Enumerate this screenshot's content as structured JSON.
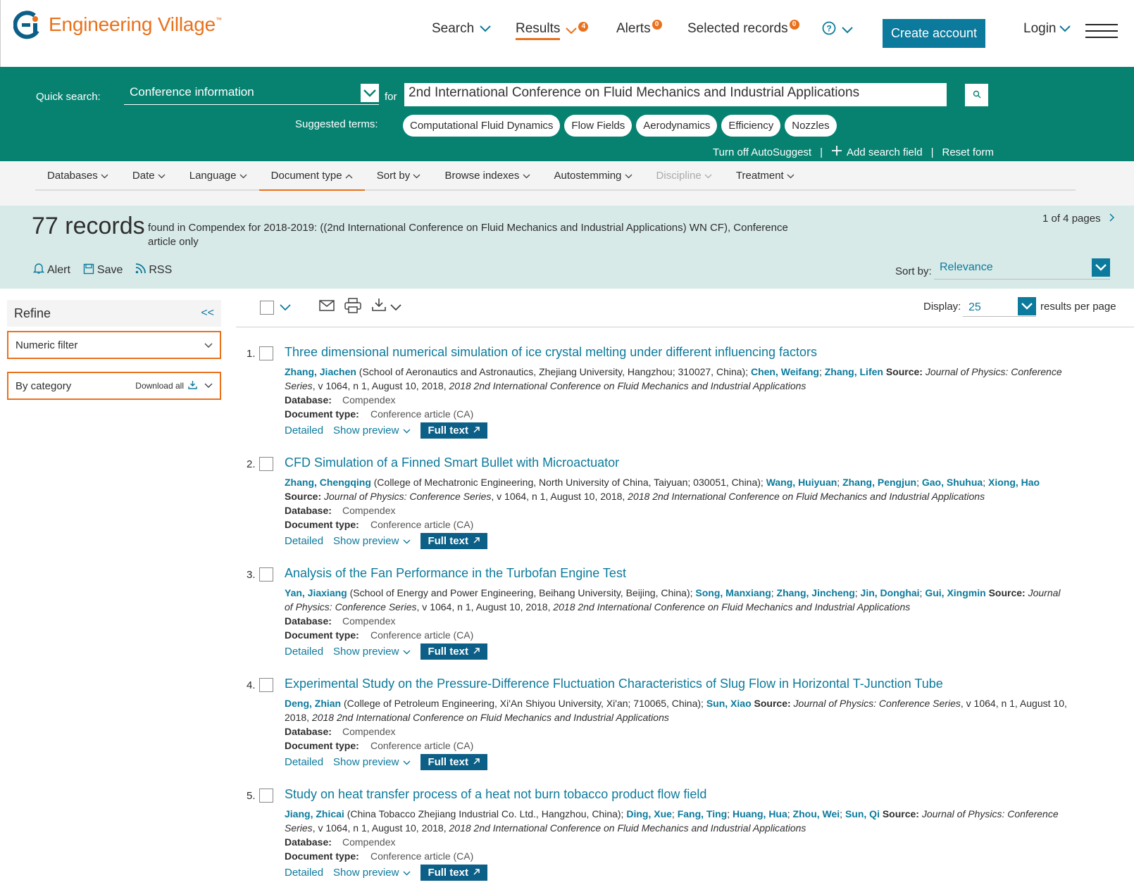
{
  "brand": {
    "name": "Engineering Village",
    "tm": "™",
    "accent": "#e9711c",
    "primary": "#0c7a9c",
    "green": "#078271"
  },
  "topnav": {
    "search": "Search",
    "results": "Results",
    "results_badge": "4",
    "alerts": "Alerts",
    "alerts_badge": "0",
    "selected": "Selected records",
    "selected_badge": "0",
    "help_icon": "help-circle-icon",
    "create_account": "Create account",
    "login": "Login"
  },
  "quick_search": {
    "label": "Quick search:",
    "field": "Conference information",
    "for": "for",
    "query": "2nd International Conference on Fluid Mechanics and Industrial Applications",
    "suggested_label": "Suggested terms:",
    "suggested": [
      "Computational Fluid Dynamics",
      "Flow Fields",
      "Aerodynamics",
      "Efficiency",
      "Nozzles"
    ],
    "turn_off": "Turn off AutoSuggest",
    "add_field": "Add search field",
    "reset": "Reset form"
  },
  "toolbar": [
    "Databases",
    "Date",
    "Language",
    "Document type",
    "Sort by",
    "Browse indexes",
    "Autostemming",
    "Discipline",
    "Treatment"
  ],
  "banner": {
    "count": "77 records",
    "description": "found in Compendex for 2018-2019: ((2nd International Conference on Fluid Mechanics and Industrial Applications) WN CF), Conference article only",
    "pages": "1 of 4 pages",
    "alert": "Alert",
    "save": "Save",
    "rss": "RSS",
    "sort_label": "Sort by:",
    "sort_value": "Relevance"
  },
  "refine": {
    "title": "Refine",
    "collapse": "<<",
    "numeric": "Numeric filter",
    "category": "By category",
    "download_all": "Download all"
  },
  "display": {
    "label": "Display:",
    "value": "25",
    "after": "results per page"
  },
  "labels": {
    "database": "Database:",
    "doctype": "Document type:",
    "detailed": "Detailed",
    "preview": "Show preview",
    "fulltext": "Full text",
    "source": "Source:"
  },
  "records": [
    {
      "num": "1.",
      "title": "Three dimensional numerical simulation of ice crystal melting under different influencing factors",
      "first_author": "Zhang, Jiachen",
      "affil": " (School of Aeronautics and Astronautics, Zhejiang University, Hangzhou; 310027, China); ",
      "others": [
        "Chen, Weifang",
        "Zhang, Lifen"
      ],
      "source_journal": "Journal of Physics: Conference Series",
      "source_rest": ", v 1064, n 1, August 10, 2018, ",
      "source_conf": "2018 2nd International Conference on Fluid Mechanics and Industrial Applications",
      "database": "Compendex",
      "doctype": "Conference article (CA)"
    },
    {
      "num": "2.",
      "title": "CFD Simulation of a Finned Smart Bullet with Microactuator",
      "first_author": "Zhang, Chengqing",
      "affil": " (College of Mechatronic Engineering, North University of China, Taiyuan; 030051, China); ",
      "others": [
        "Wang, Huiyuan",
        "Zhang, Pengjun",
        "Gao, Shuhua",
        "Xiong, Hao"
      ],
      "source_journal": "Journal of Physics: Conference Series",
      "source_rest": ", v 1064, n 1, August 10, 2018, ",
      "source_conf": "2018 2nd International Conference on Fluid Mechanics and Industrial Applications",
      "database": "Compendex",
      "doctype": "Conference article (CA)"
    },
    {
      "num": "3.",
      "title": "Analysis of the Fan Performance in the Turbofan Engine Test",
      "first_author": "Yan, Jiaxiang",
      "affil": " (School of Energy and Power Engineering, Beihang University, Beijing, China); ",
      "others": [
        "Song, Manxiang",
        "Zhang, Jincheng",
        "Jin, Donghai",
        "Gui, Xingmin"
      ],
      "source_journal": "Journal of Physics: Conference Series",
      "source_rest": ", v 1064, n 1, August 10, 2018, ",
      "source_conf": "2018 2nd International Conference on Fluid Mechanics and Industrial Applications",
      "database": "Compendex",
      "doctype": "Conference article (CA)"
    },
    {
      "num": "4.",
      "title": "Experimental Study on the Pressure-Difference Fluctuation Characteristics of Slug Flow in Horizontal T-Junction Tube",
      "first_author": "Deng, Zhian",
      "affil": " (College of Petroleum Engineering, Xi'An Shiyou University, Xi'an; 710065, China); ",
      "others": [
        "Sun, Xiao"
      ],
      "source_journal": "Journal of Physics: Conference Series",
      "source_rest": ", v 1064, n 1, August 10, 2018, ",
      "source_conf": "2018 2nd International Conference on Fluid Mechanics and Industrial Applications",
      "database": "Compendex",
      "doctype": "Conference article (CA)"
    },
    {
      "num": "5.",
      "title": "Study on heat transfer process of a heat not burn tobacco product flow field",
      "first_author": "Jiang, Zhicai",
      "affil": " (China Tobacco Zhejiang Industrial Co. Ltd., Hangzhou, China); ",
      "others": [
        "Ding, Xue",
        "Fang, Ting",
        "Huang, Hua",
        "Zhou, Wei",
        "Sun, Qi"
      ],
      "source_journal": "Journal of Physics: Conference Series",
      "source_rest": ", v 1064, n 1, August 10, 2018, ",
      "source_conf": "2018 2nd International Conference on Fluid Mechanics and Industrial Applications",
      "database": "Compendex",
      "doctype": "Conference article (CA)"
    }
  ]
}
